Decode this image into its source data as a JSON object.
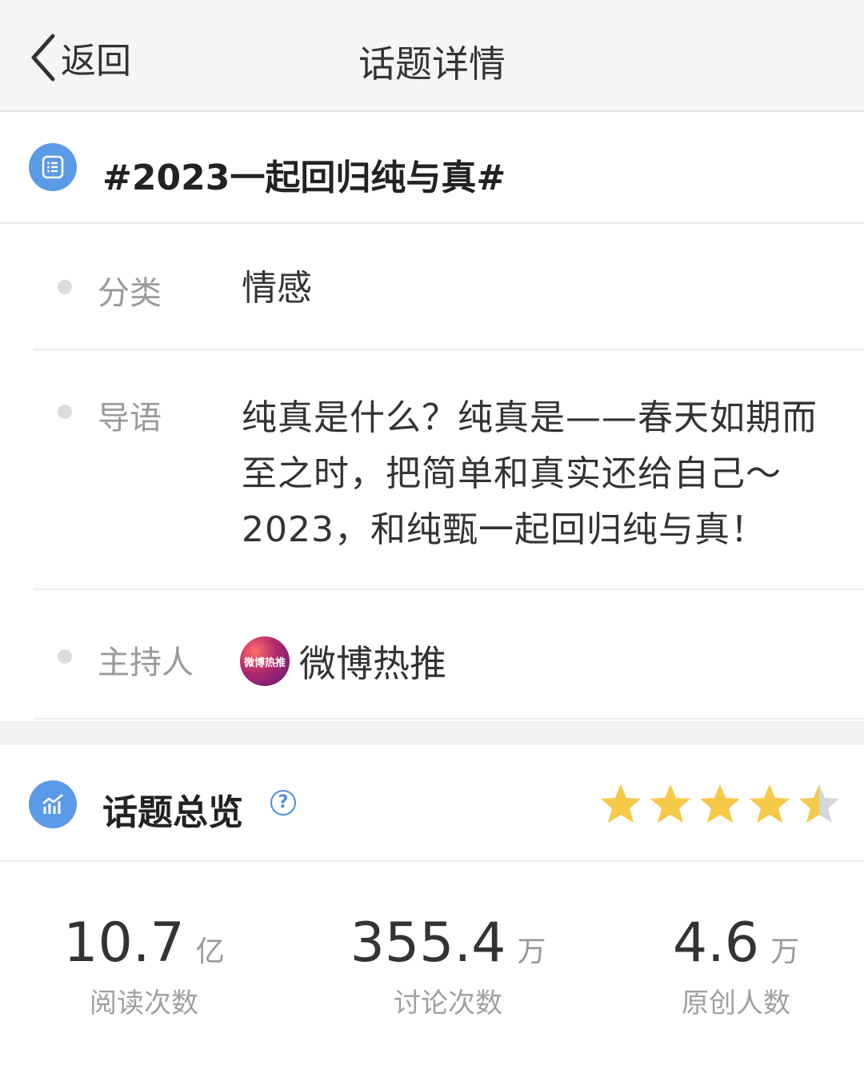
{
  "navbar": {
    "back_label": "返回",
    "title": "话题详情"
  },
  "topic": {
    "title": "#2023一起回归纯与真#",
    "icon": "list-document-icon"
  },
  "info": {
    "category": {
      "label": "分类",
      "value": "情感"
    },
    "intro": {
      "label": "导语",
      "lines": [
        "纯真是什么？纯真是——春天如期而",
        "至之时，把简单和真实还给自己～",
        "2023，和纯甄一起回归纯与真！"
      ]
    },
    "host": {
      "label": "主持人",
      "name": "微博热推",
      "avatar_text": "微博热推"
    }
  },
  "overview": {
    "title": "话题总览",
    "help_icon": "question-circle-icon",
    "icon": "bar-chart-icon",
    "rating": 4.5,
    "rating_max": 5,
    "star_color": "#f7c948",
    "star_empty_color": "#d6d6d6"
  },
  "stats": [
    {
      "value": "10.7",
      "unit": "亿",
      "caption": "阅读次数"
    },
    {
      "value": "355.4",
      "unit": "万",
      "caption": "讨论次数"
    },
    {
      "value": "4.6",
      "unit": "万",
      "caption": "原创人数"
    }
  ],
  "colors": {
    "accent": "#5b9ae6",
    "header_bg": "#f5f5f5"
  }
}
